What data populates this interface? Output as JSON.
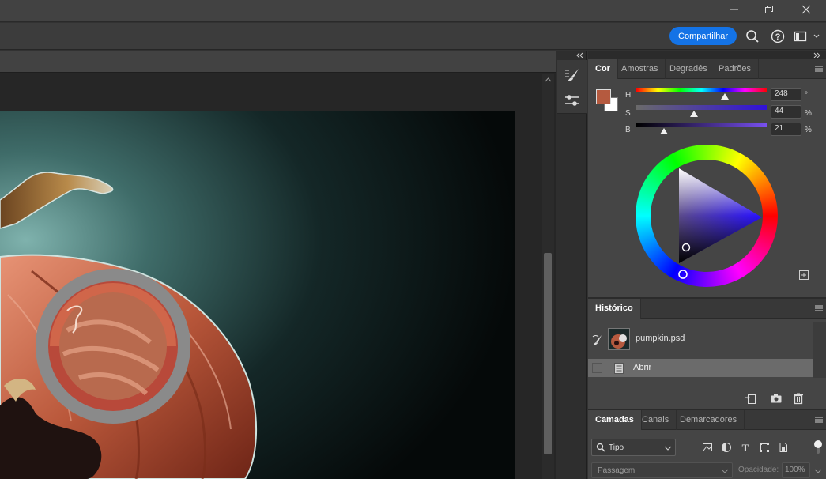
{
  "titlebar": {
    "minimize_icon": "minimize-icon",
    "restore_icon": "restore-icon",
    "close_icon": "close-icon"
  },
  "optionsbar": {
    "share_label": "Compartilhar",
    "search_icon": "search-icon",
    "help_icon": "help-icon",
    "workspace_icon": "workspace-icon"
  },
  "document": {
    "image": "pumpkin illustration"
  },
  "color_panel": {
    "tabs": [
      "Cor",
      "Amostras",
      "Degradês",
      "Padrões"
    ],
    "active_tab": "Cor",
    "foreground_color": "#b55a3f",
    "background_color": "#ffffff",
    "sliders": [
      {
        "label": "H",
        "value": "248",
        "unit": "°",
        "fraction": 0.68
      },
      {
        "label": "S",
        "value": "44",
        "unit": "%",
        "fraction": 0.44
      },
      {
        "label": "B",
        "value": "21",
        "unit": "%",
        "fraction": 0.21
      }
    ]
  },
  "history_panel": {
    "tab": "Histórico",
    "snapshot_name": "pumpkin.psd",
    "steps": [
      "Abrir"
    ]
  },
  "layers_panel": {
    "tabs": [
      "Camadas",
      "Canais",
      "Demarcadores"
    ],
    "active_tab": "Camadas",
    "filter_kind": "Tipo",
    "blend_mode": "Passagem",
    "opacity_label": "Opacidade:",
    "opacity_value": "100%"
  },
  "colors": {
    "accent": "#1473e6",
    "panel_bg": "#454545"
  }
}
